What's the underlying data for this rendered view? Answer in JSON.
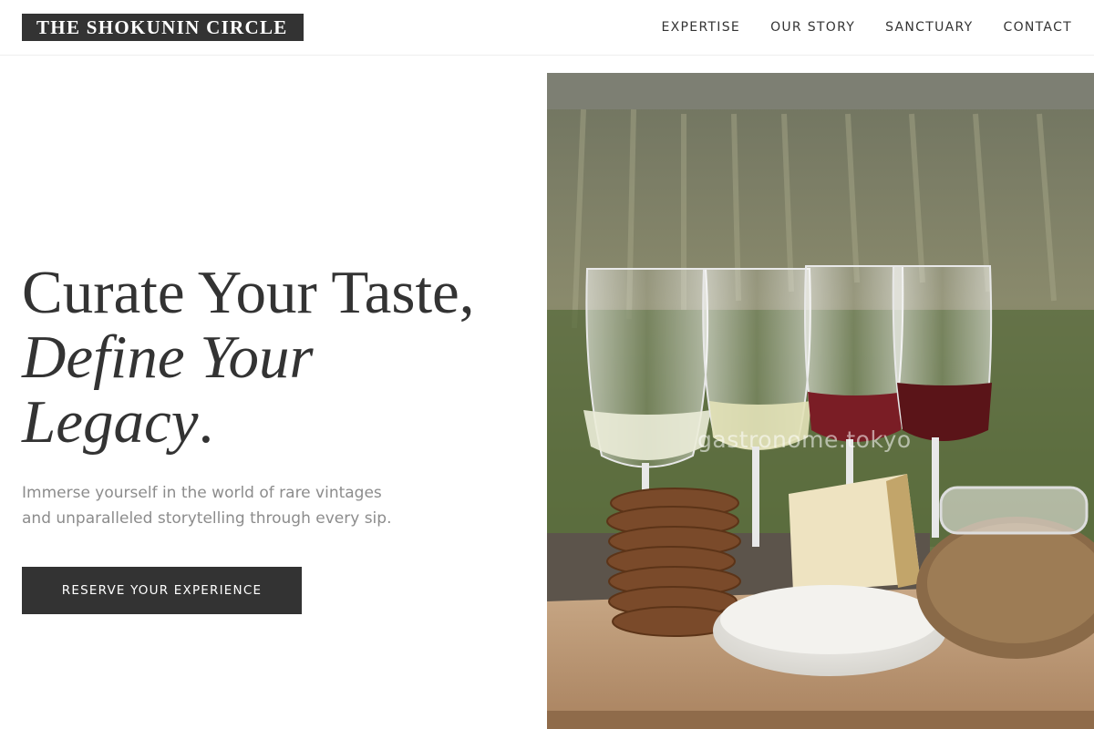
{
  "brand": {
    "name": "THE SHOKUNIN CIRCLE"
  },
  "nav": {
    "items": [
      {
        "label": "EXPERTISE"
      },
      {
        "label": "OUR STORY"
      },
      {
        "label": "SANCTUARY"
      },
      {
        "label": "CONTACT"
      }
    ]
  },
  "hero": {
    "headline_line1": "Curate Your Taste,",
    "headline_line2": "Define Your",
    "headline_line3": "Legacy",
    "headline_period": ".",
    "lede_line1": "Immerse yourself in the world of rare vintages",
    "lede_line2": "and unparalleled storytelling through every sip.",
    "cta_label": "RESERVE YOUR EXPERIENCE",
    "image_alt": "Wine glasses with cheese and crackers in a vineyard",
    "image_watermark": "gastronome.tokyo"
  },
  "colors": {
    "primary_dark": "#333333",
    "muted_text": "#8c8c8c",
    "background": "#ffffff"
  }
}
